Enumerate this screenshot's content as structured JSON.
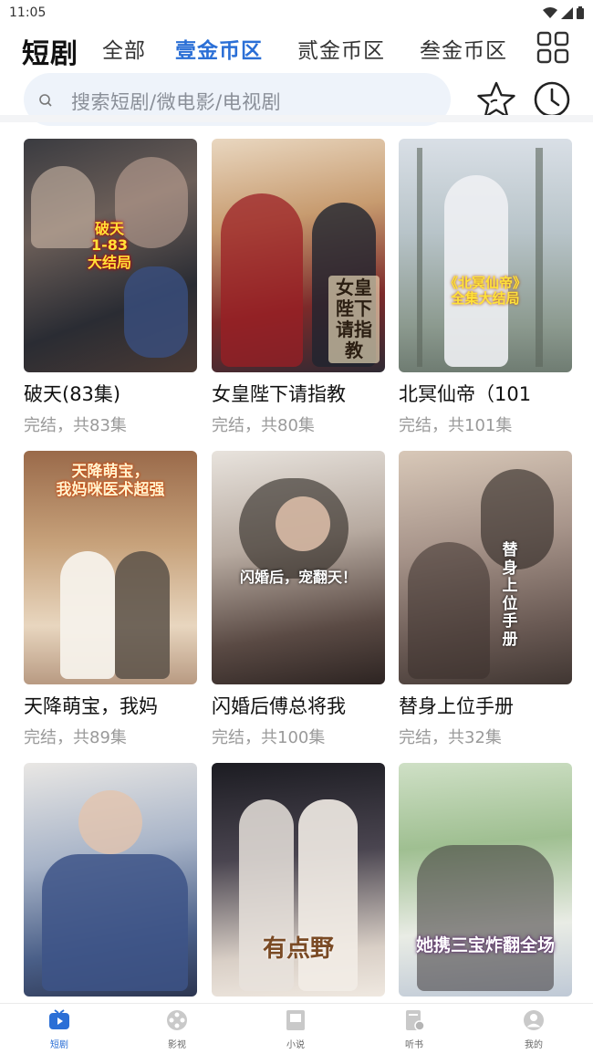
{
  "status_bar": {
    "time": "11:05"
  },
  "header": {
    "title": "短剧",
    "tabs": [
      {
        "label": "全部",
        "active": false
      },
      {
        "label": "壹金币区",
        "active": true
      },
      {
        "label": "贰金币区",
        "active": false
      },
      {
        "label": "叁金币区",
        "active": false
      }
    ],
    "grid_icon": "grid-icon"
  },
  "search": {
    "placeholder": "搜索短剧/微电影/电视剧",
    "favorite_icon": "star-icon",
    "history_icon": "clock-icon"
  },
  "dramas": [
    {
      "title": "破天(83集)",
      "status": "完结，共83集",
      "poster_text": "破天\n1-83\n大结局"
    },
    {
      "title": "女皇陛下请指教",
      "status": "完结，共80集",
      "poster_text": "女皇陛下请指教"
    },
    {
      "title": "北冥仙帝（101",
      "status": "完结，共101集",
      "poster_text": "《北冥仙帝》\n全集大结局"
    },
    {
      "title": "天降萌宝，我妈",
      "status": "完结，共89集",
      "poster_text": "天降萌宝，\n我妈咪医术超强"
    },
    {
      "title": "闪婚后傅总将我",
      "status": "完结，共100集",
      "poster_text": "闪婚后，宠翻天！"
    },
    {
      "title": "替身上位手册",
      "status": "完结，共32集",
      "poster_text": "替身上位手册"
    },
    {
      "title": "",
      "status": "",
      "poster_text": ""
    },
    {
      "title": "",
      "status": "",
      "poster_text": "有点野"
    },
    {
      "title": "",
      "status": "",
      "poster_text": "她携三宝炸翻全场"
    }
  ],
  "tabbar": {
    "items": [
      {
        "label": "短剧",
        "icon": "tv-icon",
        "active": true
      },
      {
        "label": "影视",
        "icon": "film-reel-icon",
        "active": false
      },
      {
        "label": "小说",
        "icon": "book-icon",
        "active": false
      },
      {
        "label": "听书",
        "icon": "headphone-book-icon",
        "active": false
      },
      {
        "label": "我的",
        "icon": "user-icon",
        "active": false
      }
    ]
  },
  "colors": {
    "accent": "#2b6fd6",
    "search_bg": "#eef3fa",
    "muted_text": "#9a9a9a"
  }
}
